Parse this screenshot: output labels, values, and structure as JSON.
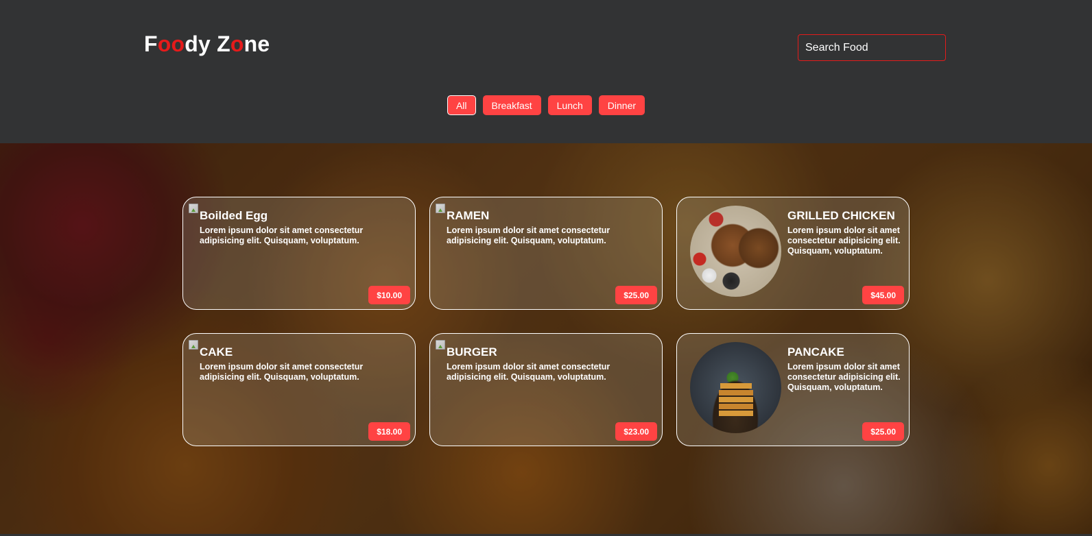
{
  "header": {
    "logo": {
      "parts": [
        {
          "text": "F",
          "red": false
        },
        {
          "text": "oo",
          "red": true
        },
        {
          "text": "dy Z",
          "red": false
        },
        {
          "text": "o",
          "red": true
        },
        {
          "text": "ne",
          "red": false
        }
      ]
    },
    "search": {
      "placeholder": "Search Food",
      "value": ""
    },
    "filters": [
      "All",
      "Breakfast",
      "Lunch",
      "Dinner"
    ],
    "active_filter": "All"
  },
  "cards": [
    {
      "title": "Boilded Egg",
      "desc": "Lorem ipsum dolor sit amet consectetur adipisicing elit. Quisquam, voluptatum.",
      "price": "$10.00",
      "image": "broken-image-icon"
    },
    {
      "title": "RAMEN",
      "desc": "Lorem ipsum dolor sit amet consectetur adipisicing elit. Quisquam, voluptatum.",
      "price": "$25.00",
      "image": "broken-image-icon"
    },
    {
      "title": "GRILLED CHICKEN",
      "desc": "Lorem ipsum dolor sit amet consectetur adipisicing elit. Quisquam, voluptatum.",
      "price": "$45.00",
      "image": "grilled-chicken-photo"
    },
    {
      "title": "CAKE",
      "desc": "Lorem ipsum dolor sit amet consectetur adipisicing elit. Quisquam, voluptatum.",
      "price": "$18.00",
      "image": "broken-image-icon"
    },
    {
      "title": "BURGER",
      "desc": "Lorem ipsum dolor sit amet consectetur adipisicing elit. Quisquam, voluptatum.",
      "price": "$23.00",
      "image": "broken-image-icon"
    },
    {
      "title": "PANCAKE",
      "desc": "Lorem ipsum dolor sit amet consectetur adipisicing elit. Quisquam, voluptatum.",
      "price": "$25.00",
      "image": "pancake-photo"
    }
  ],
  "colors": {
    "accent": "#ff4343",
    "logo_red": "#e51b1b",
    "header_bg": "#323334",
    "card_border": "#ffffff"
  }
}
